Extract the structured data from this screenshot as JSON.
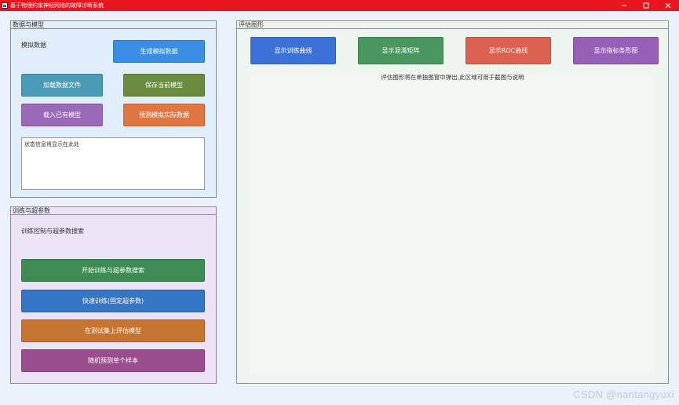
{
  "window": {
    "title": "基于物理约束神经网络的故障诊断系统",
    "minimize_glyph": "—",
    "maximize_glyph": "☐",
    "close_glyph": "✕"
  },
  "data_panel": {
    "title": "数据与模型",
    "sim_label": "模拟数据",
    "generate_button": "生成模拟数据",
    "load_file_button": "加载数据文件",
    "save_model_button": "保存当前模型",
    "load_model_button": "载入已有模型",
    "predict_button": "预测模拟实际数据",
    "status_text": "状态信息将显示在此处"
  },
  "train_panel": {
    "title": "训练与超参数",
    "subtitle": "训练控制与超参数搜索",
    "start_button": "开始训练与超参数搜索",
    "quick_button": "快速训练(固定超参数)",
    "evaluate_button": "在测试集上评估模型",
    "random_button": "随机预测单个样本"
  },
  "eval_panel": {
    "title": "评估图形",
    "train_curve_button": "显示训练曲线",
    "confusion_button": "显示混淆矩阵",
    "roc_button": "显示ROC曲线",
    "metrics_button": "显示指标条形图",
    "hint": "评估图形将在单独图窗中弹出,此区域可用于截图与说明"
  },
  "watermark": "CSDN @nantangyuxi",
  "colors": {
    "titlebar": "#e8141e",
    "generate": "#3a8ee6",
    "load_file": "#4a9bb5",
    "save_model": "#6a8a3e",
    "load_model": "#9a6ab8",
    "predict": "#df7642",
    "start": "#3d8c56",
    "quick": "#3475c4",
    "evaluate": "#c67431",
    "random": "#9b4e8e",
    "train_curve": "#3c71d8",
    "confusion": "#4a9660",
    "roc": "#dc6151",
    "metrics": "#9660b9"
  }
}
